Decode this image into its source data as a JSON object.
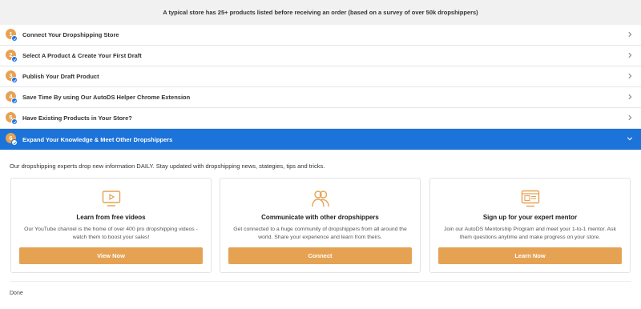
{
  "banner": {
    "text": "A typical store has 25+ products listed before receiving an order (based on a survey of over 50k dropshippers)"
  },
  "steps": [
    {
      "number": "1",
      "label": "Connect Your Dropshipping Store"
    },
    {
      "number": "2",
      "label": "Select A Product & Create Your First Draft"
    },
    {
      "number": "3",
      "label": "Publish Your Draft Product"
    },
    {
      "number": "4",
      "label": "Save Time By using Our AutoDS Helper Chrome Extension"
    },
    {
      "number": "5",
      "label": "Have Existing Products in Your Store?"
    },
    {
      "number": "6",
      "label": "Expand Your Knowledge & Meet Other Dropshippers"
    }
  ],
  "expanded": {
    "intro": "Our dropshipping experts drop new information DAILY. Stay updated with dropshipping news, stategies, tips and tricks.",
    "cards": [
      {
        "icon": "video-play-icon",
        "title": "Learn from free videos",
        "description": "Our YouTube channel is the home of over 400 pro dropshipping videos - watch them to boost your sales!",
        "button": "View Now"
      },
      {
        "icon": "community-icon",
        "title": "Communicate with other dropshippers",
        "description": "Get connected to a huge community of dropshippers from all around the world. Share your experience and learn from theirs.",
        "button": "Connect"
      },
      {
        "icon": "mentor-screen-icon",
        "title": "Sign up for your expert mentor",
        "description": "Join our AutoDS Mentorship Program and meet your 1-to-1 mentor. Ask them questions anytime and make progress on your store.",
        "button": "Learn Now"
      }
    ]
  },
  "footer": {
    "done_label": "Done"
  },
  "colors": {
    "accent": "#e6a253",
    "active_row": "#1c73d9",
    "check": "#1a73e8"
  }
}
